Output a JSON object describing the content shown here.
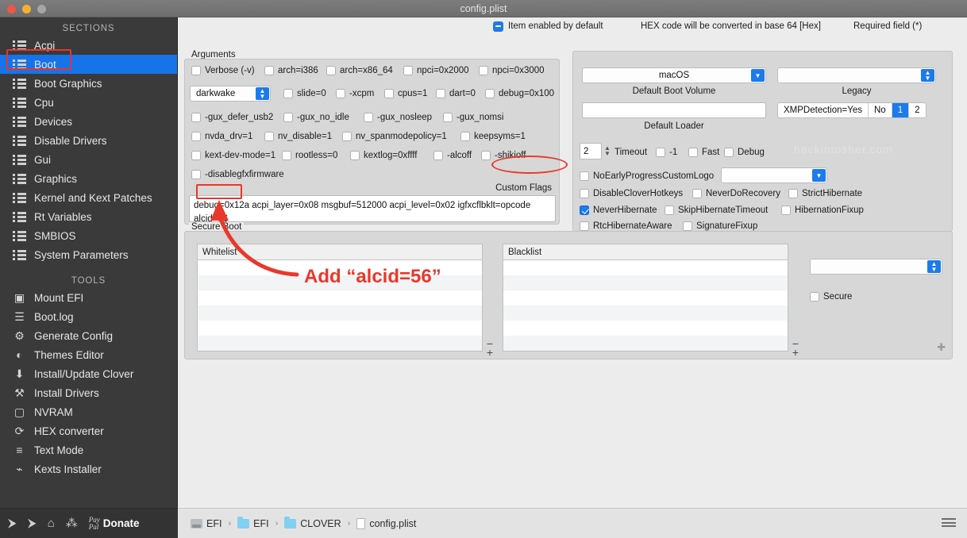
{
  "window": {
    "title": "config.plist"
  },
  "sidebar": {
    "sections_header": "SECTIONS",
    "tools_header": "TOOLS",
    "sections": [
      {
        "label": "Acpi",
        "icon": "list-icon"
      },
      {
        "label": "Boot",
        "icon": "list-icon"
      },
      {
        "label": "Boot Graphics",
        "icon": "list-icon"
      },
      {
        "label": "Cpu",
        "icon": "list-icon"
      },
      {
        "label": "Devices",
        "icon": "list-icon"
      },
      {
        "label": "Disable Drivers",
        "icon": "list-icon"
      },
      {
        "label": "Gui",
        "icon": "list-icon"
      },
      {
        "label": "Graphics",
        "icon": "list-icon"
      },
      {
        "label": "Kernel and Kext Patches",
        "icon": "list-icon"
      },
      {
        "label": "Rt Variables",
        "icon": "list-icon"
      },
      {
        "label": "SMBIOS",
        "icon": "list-icon"
      },
      {
        "label": "System Parameters",
        "icon": "list-icon"
      }
    ],
    "selected_section": "Boot",
    "tools": [
      {
        "label": "Mount EFI",
        "icon": "disk-mount-icon",
        "glyph": "▣"
      },
      {
        "label": "Boot.log",
        "icon": "log-search-icon",
        "glyph": "☰"
      },
      {
        "label": "Generate Config",
        "icon": "gears-icon",
        "glyph": "⚙"
      },
      {
        "label": "Themes Editor",
        "icon": "palette-icon",
        "glyph": "◐"
      },
      {
        "label": "Install/Update Clover",
        "icon": "download-icon",
        "glyph": "⬇"
      },
      {
        "label": "Install Drivers",
        "icon": "tools-icon",
        "glyph": "⚒"
      },
      {
        "label": "NVRAM",
        "icon": "chip-icon",
        "glyph": "▢"
      },
      {
        "label": "HEX converter",
        "icon": "refresh-icon",
        "glyph": "⟳"
      },
      {
        "label": "Text Mode",
        "icon": "text-lines-icon",
        "glyph": "≡"
      },
      {
        "label": "Kexts Installer",
        "icon": "plug-icon",
        "glyph": "⌁"
      }
    ],
    "bottom_bar": {
      "icons": [
        {
          "name": "import-icon",
          "glyph": "⮞"
        },
        {
          "name": "export-icon",
          "glyph": "⮞"
        },
        {
          "name": "home-icon",
          "glyph": "⌂"
        },
        {
          "name": "share-icon",
          "glyph": "⁂"
        }
      ],
      "paypal_line1": "Pay",
      "paypal_line2": "Pal",
      "donate_label": "Donate"
    }
  },
  "topbar": {
    "item_enabled_label": "Item enabled by default",
    "hex_note": "HEX code will be converted in base 64 [Hex]",
    "required_note": "Required field (*)"
  },
  "arguments": {
    "group_label": "Arguments",
    "row1": [
      {
        "label": "Verbose (-v)",
        "checked": false
      },
      {
        "label": "arch=i386",
        "checked": false
      },
      {
        "label": "arch=x86_64",
        "checked": false
      },
      {
        "label": "npci=0x2000",
        "checked": false
      },
      {
        "label": "npci=0x3000",
        "checked": false
      }
    ],
    "darkwake_value": "darkwake",
    "row2": [
      {
        "label": "slide=0",
        "checked": false
      },
      {
        "label": "-xcpm",
        "checked": false
      },
      {
        "label": "cpus=1",
        "checked": false
      },
      {
        "label": "dart=0",
        "checked": false
      },
      {
        "label": "debug=0x100",
        "checked": false
      }
    ],
    "row3": [
      {
        "label": "-gux_defer_usb2",
        "checked": false
      },
      {
        "label": "-gux_no_idle",
        "checked": false
      },
      {
        "label": "-gux_nosleep",
        "checked": false
      },
      {
        "label": "-gux_nomsi",
        "checked": false
      }
    ],
    "row4": [
      {
        "label": "nvda_drv=1",
        "checked": false
      },
      {
        "label": "nv_disable=1",
        "checked": false
      },
      {
        "label": "nv_spanmodepolicy=1",
        "checked": false
      },
      {
        "label": "keepsyms=1",
        "checked": false
      }
    ],
    "row5": [
      {
        "label": "kext-dev-mode=1",
        "checked": false
      },
      {
        "label": "rootless=0",
        "checked": false
      },
      {
        "label": "kextlog=0xffff",
        "checked": false
      },
      {
        "label": "-alcoff",
        "checked": false
      },
      {
        "label": "-shikioff",
        "checked": false
      }
    ],
    "row6": [
      {
        "label": "-disablegfxfirmware",
        "checked": false
      }
    ],
    "custom_flags_label": "Custom Flags",
    "custom_flags_line1": "debug=0x12a acpi_layer=0x08 msgbuf=512000 acpi_level=0x02 igfxcflbklt=opcode",
    "custom_flags_line2": "alcid=56"
  },
  "boot_options": {
    "default_boot_volume_value": "macOS",
    "default_boot_volume_caption": "Default Boot Volume",
    "legacy_value": "",
    "legacy_caption": "Legacy",
    "default_loader_value": "",
    "default_loader_caption": "Default Loader",
    "xmp_segments": [
      {
        "label": "XMPDetection=Yes",
        "active": false
      },
      {
        "label": "No",
        "active": false
      },
      {
        "label": "1",
        "active": true
      },
      {
        "label": "2",
        "active": false
      }
    ],
    "timeout_value": "2",
    "timeout_label": "Timeout",
    "timeout_checks": [
      {
        "label": "-1",
        "checked": false
      },
      {
        "label": "Fast",
        "checked": false
      },
      {
        "label": "Debug",
        "checked": false
      }
    ],
    "no_early_progress": {
      "label": "NoEarlyProgress",
      "checked": false
    },
    "custom_logo_label": "CustomLogo",
    "custom_logo_value": "",
    "flags_row1": [
      {
        "label": "DisableCloverHotkeys",
        "checked": false
      },
      {
        "label": "NeverDoRecovery",
        "checked": false
      },
      {
        "label": "StrictHibernate",
        "checked": false
      }
    ],
    "flags_row2": [
      {
        "label": "NeverHibernate",
        "checked": true
      },
      {
        "label": "SkipHibernateTimeout",
        "checked": false
      },
      {
        "label": "HibernationFixup",
        "checked": false
      }
    ],
    "flags_row3": [
      {
        "label": "RtcHibernateAware",
        "checked": false
      },
      {
        "label": "SignatureFixup",
        "checked": false
      }
    ]
  },
  "secure_boot": {
    "group_label": "Secure Boot",
    "whitelist_header": "Whitelist",
    "whitelist_rows": [
      "",
      "",
      "",
      "",
      "",
      ""
    ],
    "blacklist_header": "Blacklist",
    "blacklist_rows": [
      "",
      "",
      "",
      "",
      "",
      ""
    ],
    "policy_value": "",
    "secure_checkbox": {
      "label": "Secure",
      "checked": false
    },
    "add_button": "+",
    "remove_button": "−"
  },
  "breadcrumb": {
    "items": [
      {
        "label": "EFI",
        "icon": "disk-icon"
      },
      {
        "label": "EFI",
        "icon": "folder-icon"
      },
      {
        "label": "CLOVER",
        "icon": "folder-icon"
      },
      {
        "label": "config.plist",
        "icon": "document-icon"
      }
    ],
    "separator": "›"
  },
  "annotation": {
    "add_text": "Add “alcid=56”",
    "color": "#e8382b"
  },
  "watermark": "hackintosher.com"
}
